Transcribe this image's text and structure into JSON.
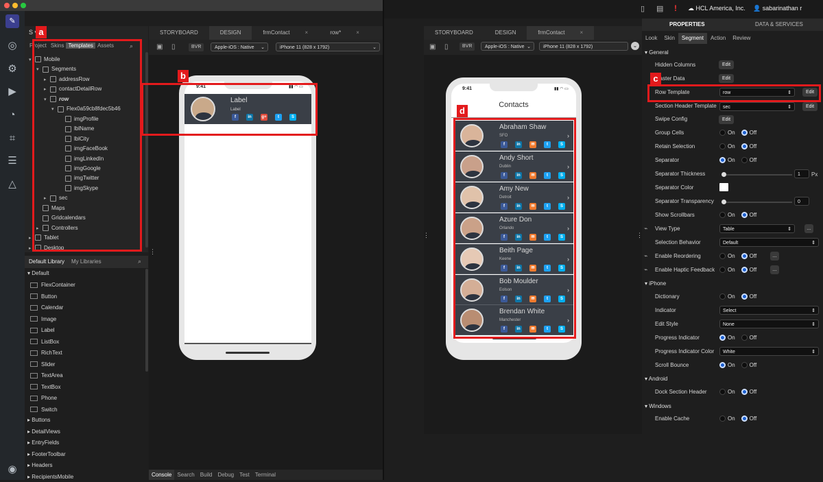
{
  "left_panel": {
    "project_prefix": "S",
    "tabs": [
      "Project",
      "Skins",
      "Templates",
      "Assets"
    ],
    "active_tab": "Templates",
    "tree": [
      {
        "label": "Mobile",
        "depth": 0,
        "icon": "phone-icon",
        "arrow": "▾"
      },
      {
        "label": "Segments",
        "depth": 1,
        "icon": "phone-icon",
        "arrow": "▾"
      },
      {
        "label": "addressRow",
        "depth": 2,
        "icon": "phone-icon",
        "arrow": "▸"
      },
      {
        "label": "contactDetailRow",
        "depth": 2,
        "icon": "phone-icon",
        "arrow": "▸"
      },
      {
        "label": "row",
        "depth": 2,
        "icon": "phone-icon",
        "arrow": "▾"
      },
      {
        "label": "Flex0a59cb8fdec5b46",
        "depth": 3,
        "icon": "flex-icon",
        "arrow": "▾"
      },
      {
        "label": "imgProfile",
        "depth": 4,
        "icon": "image-icon",
        "arrow": ""
      },
      {
        "label": "lblName",
        "depth": 4,
        "icon": "label-icon",
        "arrow": ""
      },
      {
        "label": "lblCity",
        "depth": 4,
        "icon": "label-icon",
        "arrow": ""
      },
      {
        "label": "imgFaceBook",
        "depth": 4,
        "icon": "image-icon",
        "arrow": ""
      },
      {
        "label": "imgLinkedIn",
        "depth": 4,
        "icon": "image-icon",
        "arrow": ""
      },
      {
        "label": "imgGoogle",
        "depth": 4,
        "icon": "image-icon",
        "arrow": ""
      },
      {
        "label": "imgTwitter",
        "depth": 4,
        "icon": "image-icon",
        "arrow": ""
      },
      {
        "label": "imgSkype",
        "depth": 4,
        "icon": "image-icon",
        "arrow": ""
      },
      {
        "label": "sec",
        "depth": 2,
        "icon": "phone-icon",
        "arrow": "▸"
      },
      {
        "label": "Maps",
        "depth": 1,
        "icon": "phone-icon",
        "arrow": ""
      },
      {
        "label": "Gridcalendars",
        "depth": 1,
        "icon": "phone-icon",
        "arrow": ""
      },
      {
        "label": "Controllers",
        "depth": 1,
        "icon": "folder-icon",
        "arrow": "▸"
      },
      {
        "label": "Tablet",
        "depth": 0,
        "icon": "tablet-icon",
        "arrow": "▸"
      },
      {
        "label": "Desktop",
        "depth": 0,
        "icon": "desktop-icon",
        "arrow": "▸"
      }
    ],
    "library_tabs": [
      "Default Library",
      "My Libraries"
    ],
    "library_group": "Default",
    "library_items": [
      "FlexContainer",
      "Button",
      "Calendar",
      "Image",
      "Label",
      "ListBox",
      "RichText",
      "Slider",
      "TextArea",
      "TextBox",
      "Phone",
      "Switch"
    ],
    "library_groups": [
      "Buttons",
      "DetailViews",
      "EntryFields",
      "FooterToolbar",
      "Headers",
      "RecipientsMobile"
    ]
  },
  "editor1": {
    "tabs": [
      "STORYBOARD",
      "DESIGN",
      "frmContact",
      "row*"
    ],
    "active_tab": "DESIGN",
    "bvr": "BVR",
    "platform": "Apple-iOS : Native",
    "device": "iPhone 11 (828 x 1792)",
    "phone_time": "9:41",
    "row_label": "Label",
    "row_sublabel": "Label",
    "bottom_tabs": [
      "Console",
      "Search",
      "Build",
      "Debug",
      "Test",
      "Terminal"
    ]
  },
  "editor2": {
    "tabs": [
      "STORYBOARD",
      "DESIGN",
      "frmContact",
      "row"
    ],
    "active_tab": "frmContact",
    "bvr": "BVR",
    "platform": "Apple-iOS : Native",
    "device": "iPhone 11 (828 x 1792)",
    "phone_time": "9:41",
    "header": "Contacts",
    "contacts": [
      {
        "name": "Abraham Shaw",
        "city": "SFO"
      },
      {
        "name": "Andy Short",
        "city": "Dublin"
      },
      {
        "name": "Amy New",
        "city": "Detroit"
      },
      {
        "name": "Azure Don",
        "city": "Orlando"
      },
      {
        "name": "Beith Page",
        "city": "Keene"
      },
      {
        "name": "Bob Moulder",
        "city": "Eolson"
      },
      {
        "name": "Brendan White",
        "city": "Manchester"
      }
    ]
  },
  "topbar": {
    "org": "HCL America, Inc.",
    "user": "sabarinathan r"
  },
  "properties": {
    "tabs": [
      "PROPERTIES",
      "DATA & SERVICES"
    ],
    "subtabs": [
      "Look",
      "Skin",
      "Segment",
      "Action",
      "Review"
    ],
    "active_subtab": "Segment",
    "sections": {
      "general": "General",
      "iphone": "iPhone",
      "android": "Android",
      "windows": "Windows"
    },
    "edit_label": "Edit",
    "on_label": "On",
    "off_label": "Off",
    "px_label": "Px",
    "rows": {
      "hidden_columns": "Hidden Columns",
      "master_data": "Master Data",
      "row_template": "Row Template",
      "row_template_value": "row",
      "section_header_template": "Section Header Template",
      "section_header_value": "sec",
      "swipe_config": "Swipe Config",
      "group_cells": "Group Cells",
      "retain_selection": "Retain Selection",
      "separator": "Separator",
      "separator_thickness": "Separator Thickness",
      "separator_thickness_value": "1",
      "separator_color": "Separator Color",
      "separator_transparency": "Separator Transparency",
      "separator_transparency_value": "0",
      "show_scrollbars": "Show Scrollbars",
      "view_type": "View Type",
      "view_type_value": "Table",
      "selection_behavior": "Selection Behavior",
      "selection_behavior_value": "Default",
      "enable_reordering": "Enable Reordering",
      "enable_haptic": "Enable Haptic Feedback",
      "dictionary": "Dictionary",
      "indicator": "Indicator",
      "indicator_value": "Select",
      "edit_style": "Edit Style",
      "edit_style_value": "None",
      "progress_indicator": "Progress Indicator",
      "progress_indicator_color": "Progress Indicator Color",
      "progress_indicator_color_value": "White",
      "scroll_bounce": "Scroll Bounce",
      "dock_section_header": "Dock Section Header",
      "enable_cache": "Enable Cache"
    }
  },
  "annotations": {
    "a": "a",
    "b": "b",
    "c": "c",
    "d": "d"
  },
  "colors": {
    "highlight": "#e31a1c",
    "accent": "#1b5fd1",
    "panel": "#252525"
  }
}
